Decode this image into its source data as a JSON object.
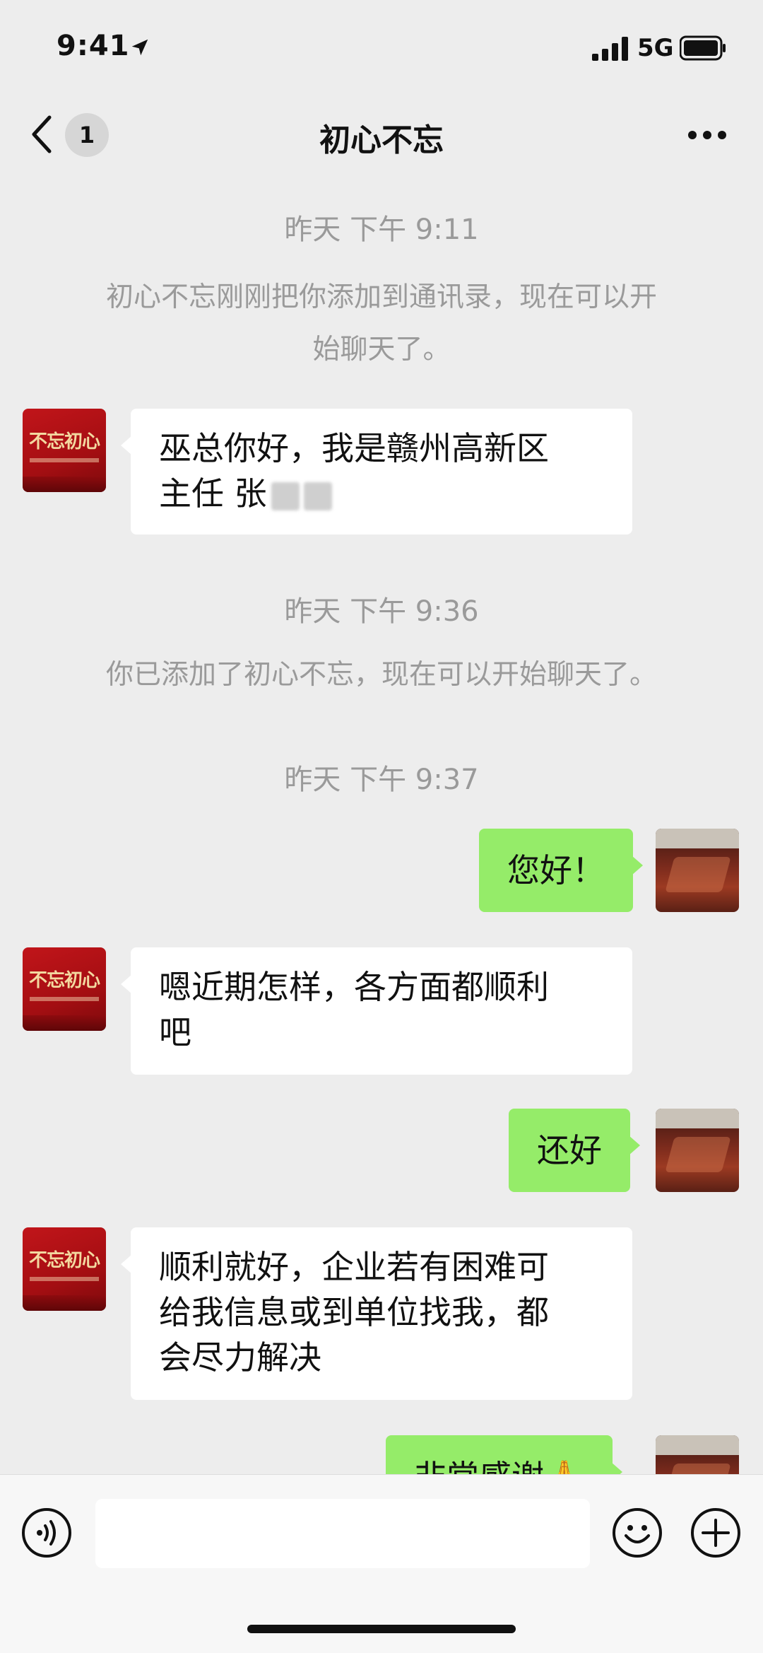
{
  "status_bar": {
    "time": "9:41",
    "network": "5G"
  },
  "nav": {
    "badge_count": "1",
    "title": "初心不忘"
  },
  "messages": {
    "ts1": "昨天 下午 9:11",
    "sys1_line1": "初心不忘刚刚把你添加到通讯录，现在可以开",
    "sys1_line2": "始聊天了。",
    "m1_line1": "巫总你好，我是赣州高新区",
    "m1_line2": "主任 张",
    "ts2": "昨天 下午 9:36",
    "sys2": "你已添加了初心不忘，现在可以开始聊天了。",
    "ts3": "昨天 下午 9:37",
    "m2": "您好！",
    "m3_line1": "嗯近期怎样，各方面都顺利",
    "m3_line2": "吧",
    "m4": "还好",
    "m5_line1": "顺利就好，企业若有困难可",
    "m5_line2": "给我信息或到单位找我，都",
    "m5_line3": "会尽力解决",
    "m6": "非常感谢🙏"
  },
  "avatars": {
    "contact_brand": "不忘初心"
  },
  "icons": {
    "back": "chevron-left-icon",
    "more": "more-dots-icon",
    "voice": "voice-icon",
    "emoji": "emoji-icon",
    "plus": "plus-icon"
  },
  "colors": {
    "background": "#ededed",
    "bubble_self": "#95ec69",
    "bubble_other": "#ffffff",
    "system_text": "#9a9a9a"
  }
}
